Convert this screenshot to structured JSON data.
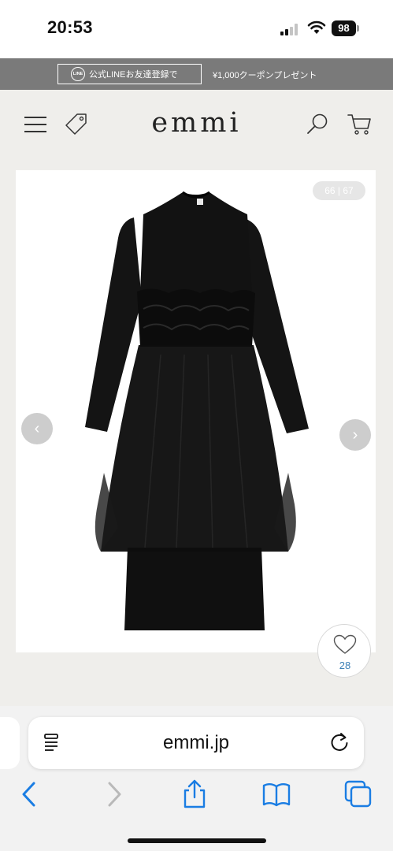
{
  "status_bar": {
    "time": "20:53",
    "battery": "98",
    "icons": [
      "signal-icon",
      "wifi-icon",
      "battery-icon"
    ]
  },
  "announcement": {
    "line_logo": "LINE",
    "line_text": "公式LINEお友達登録で",
    "coupon_text": "¥1,000クーポンプレゼント"
  },
  "header": {
    "logo": "emmi",
    "icons": [
      "menu-icon",
      "tag-icon",
      "search-icon",
      "cart-icon"
    ]
  },
  "product": {
    "counter": "66 | 67",
    "prev_arrow": "‹",
    "next_arrow": "›",
    "favorite_count": "28"
  },
  "browser": {
    "url": "emmi.jp",
    "toolbar_icons": [
      "back-icon",
      "forward-icon",
      "share-icon",
      "bookmarks-icon",
      "tabs-icon"
    ]
  },
  "colors": {
    "page_bg": "#efeeeb",
    "announcement_bg": "#7a7a7a",
    "accent_blue": "#1a7de3",
    "favorite_count": "#3a7fb5",
    "dress": "#111111"
  }
}
